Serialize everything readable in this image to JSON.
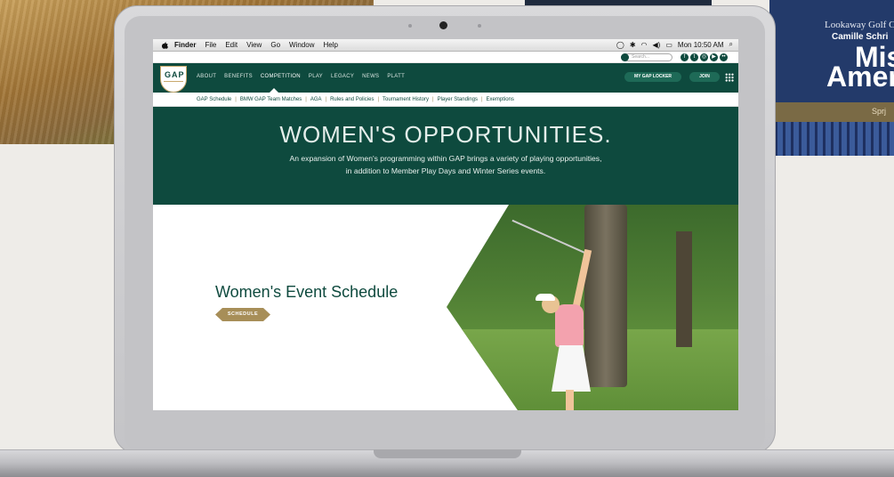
{
  "background": {
    "poster": {
      "line1": "Lookaway Golf Cl",
      "line2": "Camille Schri",
      "line3": "Miss",
      "line4": "Ameri",
      "band": "Sprj"
    }
  },
  "menubar": {
    "app": "Finder",
    "items": [
      "File",
      "Edit",
      "View",
      "Go",
      "Window",
      "Help"
    ],
    "clock": "Mon 10:50 AM"
  },
  "site": {
    "search_placeholder": "Search...",
    "logo_text": "GAP",
    "nav": [
      "ABOUT",
      "BENEFITS",
      "COMPETITION",
      "PLAY",
      "LEGACY",
      "NEWS",
      "PLATT"
    ],
    "active_nav": "COMPETITION",
    "buttons": {
      "locker": "MY GAP LOCKER",
      "join": "JOIN"
    },
    "subnav": [
      "GAP Schedule",
      "BMW GAP Team Matches",
      "AGA",
      "Rules and Policies",
      "Tournament History",
      "Player Standings",
      "Exemptions"
    ],
    "hero": {
      "title": "WOMEN'S OPPORTUNITIES.",
      "line1": "An expansion of Women's programming within GAP brings a variety of playing opportunities,",
      "line2": "in addition to Member Play Days and Winter Series events."
    },
    "feature": {
      "title": "Women's Event Schedule",
      "button": "SCHEDULE"
    }
  },
  "colors": {
    "brand_green": "#0e4a3e",
    "gold": "#a78e58"
  }
}
